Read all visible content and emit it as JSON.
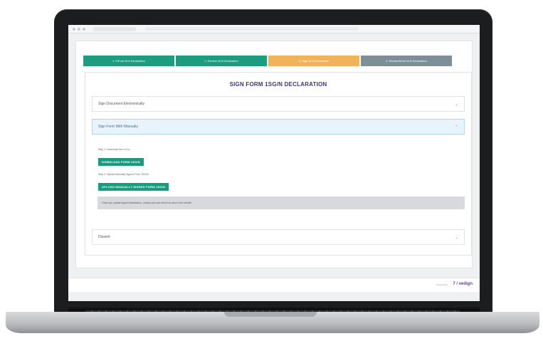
{
  "steps": [
    {
      "label": "1. Fill out W-8 Declaration",
      "color": "#1e9c80"
    },
    {
      "label": "2. Review W-8 Declaration",
      "color": "#1e9c80"
    },
    {
      "label": "3. Sign W-8 Declaration",
      "color": "#f0b35a"
    },
    {
      "label": "4. Review/Send W-8 Declaration",
      "color": "#7d8e99"
    }
  ],
  "title": "SIGN FORM 1SG/N DECLARATION",
  "accordions": {
    "first": "Sign Document Electronically",
    "second": "Sign Form With Manually",
    "third": "Dissent"
  },
  "section": {
    "step1_text": "Step 1: Download form 1G-a",
    "download_btn": "DOWNLOAD FORM 1SG/N",
    "step2_text": "Step 2: Upload Manually Signed Form 1SG/N",
    "upload_btn": "UPLOAD MANUALLY SIGNED FORM 1SG/N",
    "note": "Once you upload signed declaration, Leaves you can send it to and to the benefit"
  },
  "footer": {
    "small": "Powered by",
    "logo": "7 / vedign"
  }
}
